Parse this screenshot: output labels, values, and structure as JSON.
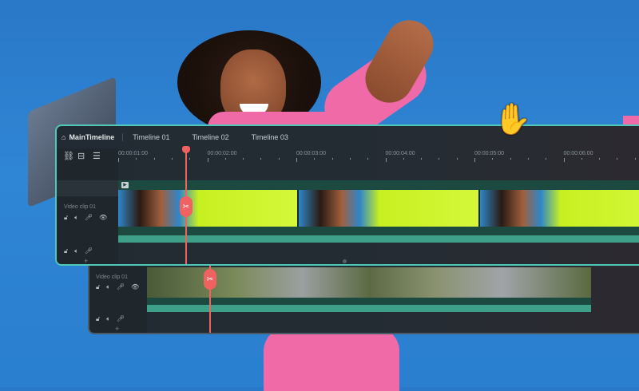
{
  "tabs": {
    "main": "MainTimeline",
    "items": [
      "Timeline 01",
      "Timeline 02",
      "Timeline 03"
    ]
  },
  "ruler": {
    "timecodes": [
      "00:00:01:00",
      "00:00:02:00",
      "00:00:03:00",
      "00:00:04:00",
      "00:00:05:00",
      "00:00:06:00"
    ]
  },
  "front": {
    "track_label": "Video clip 01"
  },
  "back": {
    "track_label": "Video clip 01"
  },
  "add_track": "+",
  "colors": {
    "accent": "#4ec9b8",
    "playhead": "#f0625f",
    "audio": "#3ea088"
  }
}
